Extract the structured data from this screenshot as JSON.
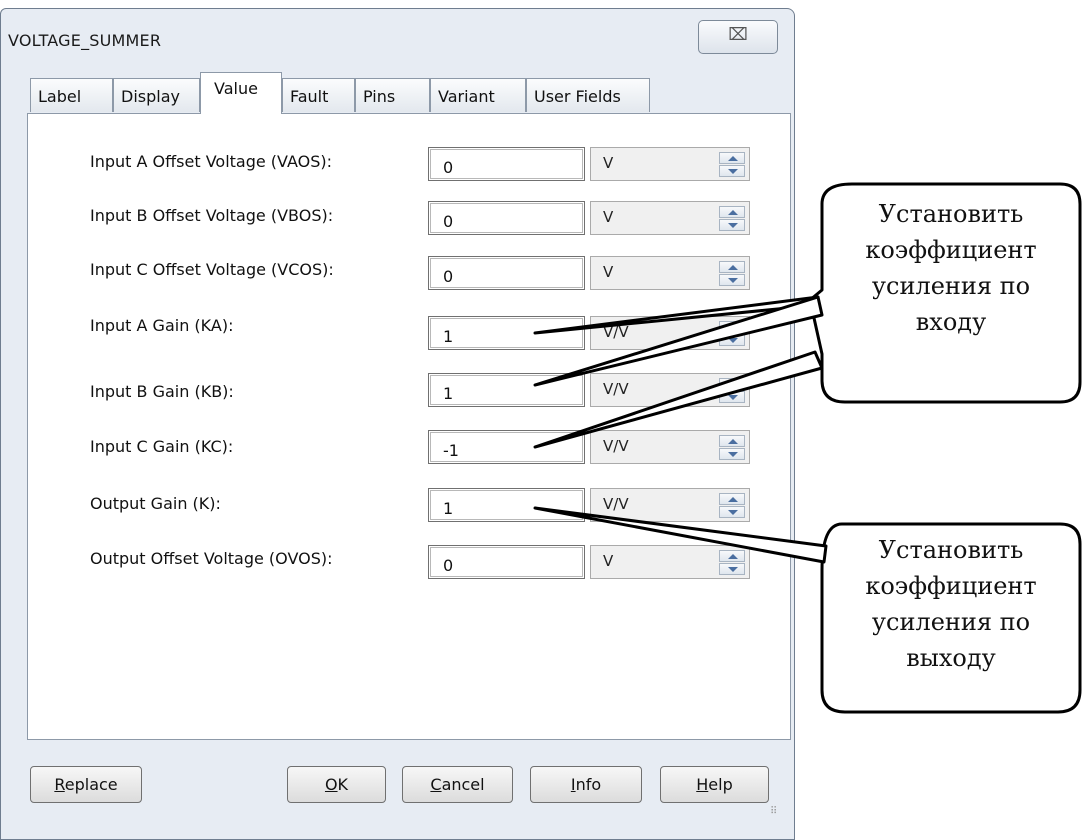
{
  "window": {
    "title": "VOLTAGE_SUMMER",
    "close_glyph": "⌧"
  },
  "tabs": [
    {
      "label": "Label",
      "active": false
    },
    {
      "label": "Display",
      "active": false
    },
    {
      "label": "Value",
      "active": true
    },
    {
      "label": "Fault",
      "active": false
    },
    {
      "label": "Pins",
      "active": false
    },
    {
      "label": "Variant",
      "active": false
    },
    {
      "label": "User Fields",
      "active": false
    }
  ],
  "rows": [
    {
      "label": "Input A Offset Voltage (VAOS):",
      "value": "0",
      "unit": "V"
    },
    {
      "label": "Input B Offset Voltage (VBOS):",
      "value": "0",
      "unit": "V"
    },
    {
      "label": "Input C Offset Voltage (VCOS):",
      "value": "0",
      "unit": "V"
    },
    {
      "label": "Input A Gain (KA):",
      "value": "1",
      "unit": "V/V"
    },
    {
      "label": "Input B Gain (KB):",
      "value": "1",
      "unit": "V/V"
    },
    {
      "label": "Input C Gain (KC):",
      "value": "-1",
      "unit": "V/V"
    },
    {
      "label": "Output Gain (K):",
      "value": "1",
      "unit": "V/V"
    },
    {
      "label": "Output Offset Voltage (OVOS):",
      "value": "0",
      "unit": "V"
    }
  ],
  "buttons": {
    "replace": {
      "mnemonic": "R",
      "rest": "eplace"
    },
    "ok": {
      "mnemonic": "O",
      "rest": "K"
    },
    "cancel": {
      "mnemonic": "C",
      "rest": "ancel"
    },
    "info": {
      "mnemonic": "I",
      "rest": "nfo"
    },
    "help": {
      "mnemonic": "H",
      "rest": "elp"
    }
  },
  "callouts": {
    "input_gain": {
      "lines": [
        "Установить",
        "коэффициент",
        "усиления по",
        "входу"
      ]
    },
    "output_gain": {
      "lines": [
        "Установить",
        "коэффициент",
        "усиления по",
        "выходу"
      ]
    }
  }
}
